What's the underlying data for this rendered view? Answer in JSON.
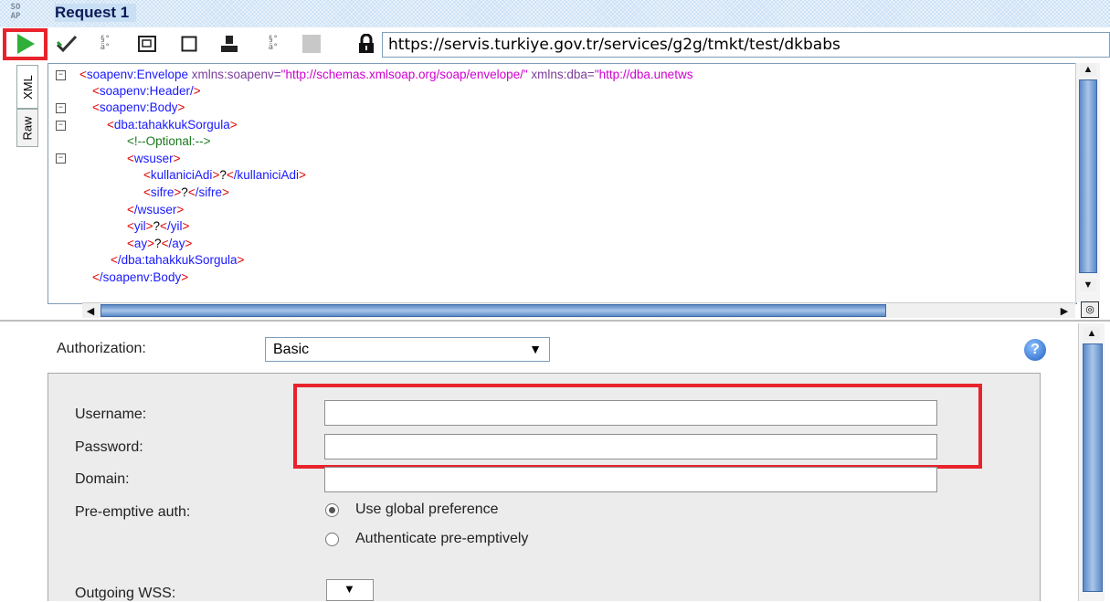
{
  "window": {
    "logo_text": "SO AP",
    "title": "Request 1"
  },
  "toolbar": {
    "url": "https://servis.turkiye.gov.tr/services/g2g/tmkt/test/dkbabs",
    "icons": [
      "play-icon",
      "check-icon",
      "format-icon",
      "window-icon",
      "square-icon",
      "user-icon",
      "format-icon",
      "grey-box-icon",
      "lock-icon"
    ]
  },
  "editor": {
    "tabs": [
      "XML",
      "Raw"
    ],
    "lines": {
      "l1_open": "<",
      "l1_tag": "soapenv:Envelope",
      "l1_attr1": " xmlns:soapenv=",
      "l1_val1": "\"http://schemas.xmlsoap.org/soap/envelope/\"",
      "l1_attr2": " xmlns:dba=",
      "l1_val2": "\"http://dba.unetws",
      "l2": "soapenv:Header/",
      "l3": "soapenv:Body",
      "l4": "dba:tahakkukSorgula",
      "l5": "<!--Optional:-->",
      "l6": "wsuser",
      "l7_tag": "kullaniciAdi",
      "l7_val": "?",
      "l7_close": "/kullaniciAdi",
      "l8_tag": "sifre",
      "l8_val": "?",
      "l8_close": "/sifre",
      "l9": "/wsuser",
      "l10_tag": "yil",
      "l10_val": "?",
      "l10_close": "/yil",
      "l11_tag": "ay",
      "l11_val": "?",
      "l11_close": "/ay",
      "l12": "/dba:tahakkukSorgula",
      "l13": "/soapenv:Body"
    }
  },
  "auth": {
    "authorization_label": "Authorization:",
    "authorization_value": "Basic",
    "username_label": "Username:",
    "password_label": "Password:",
    "domain_label": "Domain:",
    "preemptive_label": "Pre-emptive auth:",
    "option_global": "Use global preference",
    "option_preemptive": "Authenticate pre-emptively",
    "outgoing_wss_label": "Outgoing WSS:"
  },
  "colors": {
    "highlight": "#e8232c",
    "tag": "#1a1aff",
    "bracket": "#e00000",
    "attr_value": "#d000d0",
    "comment": "#1a7a1a"
  }
}
